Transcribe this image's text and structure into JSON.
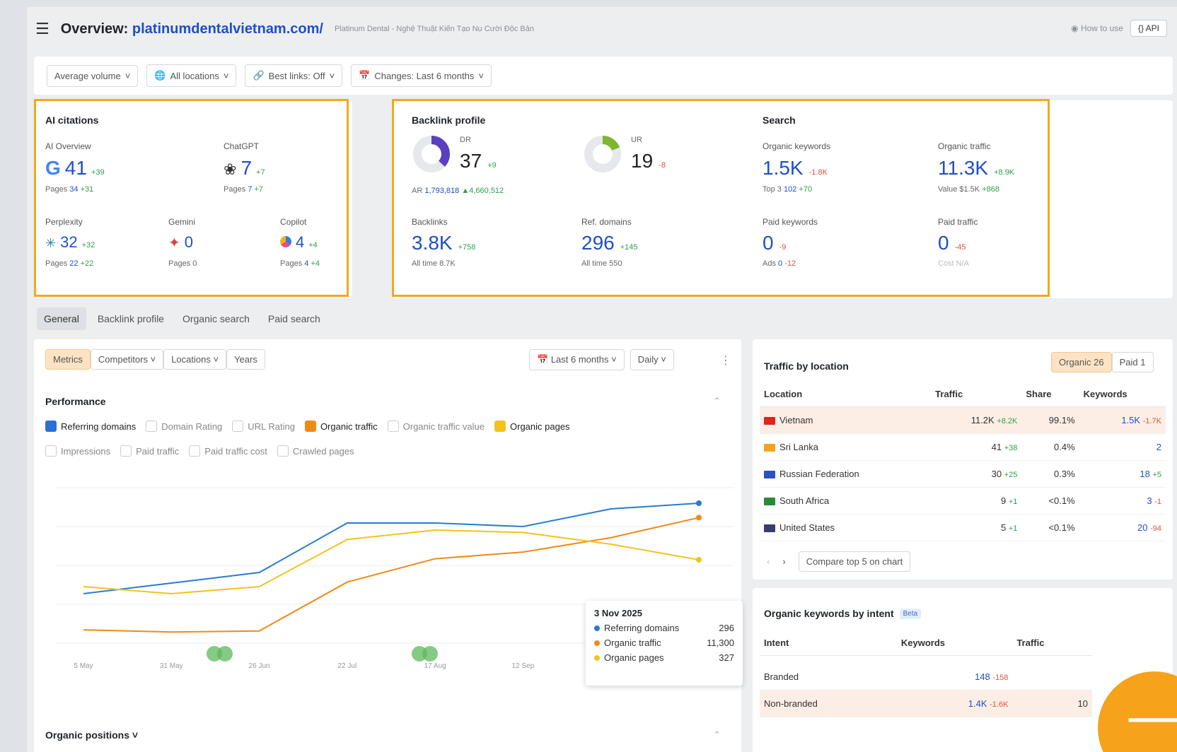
{
  "header": {
    "title_prefix": "Overview:",
    "domain": "platinumdentalvietnam.com/",
    "subtitle": "Platinum Dental - Nghệ Thuật Kiến Tạo Nụ Cười Độc Bản",
    "how_to_use": "How to use",
    "api": "API"
  },
  "filters": {
    "volume": "Average volume",
    "locations": "All locations",
    "best_links": "Best links: Off",
    "changes": "Changes: Last 6 months"
  },
  "ai_citations": {
    "title": "AI citations",
    "overview": {
      "label": "AI Overview",
      "value": "41",
      "delta": "+39",
      "pages_label": "Pages",
      "pages": "34",
      "pages_delta": "+31"
    },
    "chatgpt": {
      "label": "ChatGPT",
      "value": "7",
      "delta": "+7",
      "pages_label": "Pages",
      "pages": "7",
      "pages_delta": "+7"
    },
    "perplexity": {
      "label": "Perplexity",
      "value": "32",
      "delta": "+32",
      "pages_label": "Pages",
      "pages": "22",
      "pages_delta": "+22"
    },
    "gemini": {
      "label": "Gemini",
      "value": "0",
      "pages_label": "Pages",
      "pages": "0"
    },
    "copilot": {
      "label": "Copilot",
      "value": "4",
      "delta": "+4",
      "pages_label": "Pages",
      "pages": "4",
      "pages_delta": "+4"
    }
  },
  "backlink": {
    "title": "Backlink profile",
    "dr": {
      "label": "DR",
      "value": "37",
      "delta": "+9",
      "ar_label": "AR",
      "ar": "1,793,818",
      "ar_delta": "▲4,660,512",
      "ring_fraction": 0.37
    },
    "ur": {
      "label": "UR",
      "value": "19",
      "delta": "-8",
      "ring_fraction": 0.19
    },
    "backlinks": {
      "label": "Backlinks",
      "value": "3.8K",
      "delta": "+758",
      "sub_label": "All time",
      "sub": "8.7K"
    },
    "refdomains": {
      "label": "Ref. domains",
      "value": "296",
      "delta": "+145",
      "sub_label": "All time",
      "sub": "550"
    }
  },
  "search": {
    "title": "Search",
    "org_kw": {
      "label": "Organic keywords",
      "value": "1.5K",
      "delta": "-1.8K",
      "sub_label": "Top 3",
      "sub": "102",
      "sub_delta": "+70"
    },
    "org_traffic": {
      "label": "Organic traffic",
      "value": "11.3K",
      "delta": "+8.9K",
      "sub_label": "Value",
      "sub": "$1.5K",
      "sub_delta": "+868"
    },
    "paid_kw": {
      "label": "Paid keywords",
      "value": "0",
      "delta": "-9",
      "sub_label": "Ads",
      "sub": "0",
      "sub_delta": "-12"
    },
    "paid_traffic": {
      "label": "Paid traffic",
      "value": "0",
      "delta": "-45",
      "sub": "Cost N/A"
    }
  },
  "tabs": [
    "General",
    "Backlink profile",
    "Organic search",
    "Paid search"
  ],
  "chart_controls": {
    "metrics": "Metrics",
    "competitors": "Competitors",
    "locations": "Locations",
    "years": "Years",
    "period": "Last 6 months",
    "granularity": "Daily"
  },
  "performance": {
    "title": "Performance",
    "checkboxes": [
      {
        "label": "Referring domains",
        "state": "blue"
      },
      {
        "label": "Domain Rating",
        "state": "off"
      },
      {
        "label": "URL Rating",
        "state": "off"
      },
      {
        "label": "Organic traffic",
        "state": "orange"
      },
      {
        "label": "Organic traffic value",
        "state": "off"
      },
      {
        "label": "Organic pages",
        "state": "yellow"
      },
      {
        "label": "Impressions",
        "state": "off"
      },
      {
        "label": "Paid traffic",
        "state": "off"
      },
      {
        "label": "Paid traffic cost",
        "state": "off"
      },
      {
        "label": "Crawled pages",
        "state": "off"
      }
    ],
    "x_ticks": [
      "5 May",
      "31 May",
      "26 Jun",
      "22 Jul",
      "17 Aug",
      "12 Sep",
      "8 Oct",
      "3 Nov"
    ],
    "colors": {
      "ref": "#2a7bd1",
      "traffic": "#f08a17",
      "pages": "#f5c21b"
    }
  },
  "chart_data": {
    "type": "line",
    "x": [
      "5 May",
      "31 May",
      "26 Jun",
      "22 Jul",
      "17 Aug",
      "12 Sep",
      "8 Oct",
      "3 Nov"
    ],
    "series": [
      {
        "name": "Referring domains",
        "values": [
          170,
          185,
          200,
          270,
          270,
          265,
          290,
          298
        ]
      },
      {
        "name": "Organic traffic",
        "values": [
          1200,
          1000,
          1100,
          5500,
          7600,
          8200,
          9500,
          11300
        ]
      },
      {
        "name": "Organic pages",
        "values": [
          270,
          255,
          270,
          370,
          390,
          385,
          360,
          327
        ]
      }
    ],
    "tooltip": {
      "date": "3 Nov 2025",
      "rows": [
        {
          "name": "Referring domains",
          "value": "296"
        },
        {
          "name": "Organic traffic",
          "value": "11,300"
        },
        {
          "name": "Organic pages",
          "value": "327"
        }
      ]
    }
  },
  "organic_positions": "Organic positions",
  "traffic_by_location": {
    "title": "Traffic by location",
    "organic_btn": "Organic",
    "organic_count": "26",
    "paid_btn": "Paid",
    "paid_count": "1",
    "columns": [
      "Location",
      "Traffic",
      "Share",
      "Keywords"
    ],
    "rows": [
      {
        "location": "Vietnam",
        "traffic": "11.2K",
        "traffic_delta": "+8.2K",
        "share": "99.1%",
        "keywords": "1.5K",
        "kw_delta": "-1.7K",
        "flag": "#e0241b"
      },
      {
        "location": "Sri Lanka",
        "traffic": "41",
        "traffic_delta": "+38",
        "share": "0.4%",
        "keywords": "2",
        "kw_delta": "",
        "flag": "#f2a41f"
      },
      {
        "location": "Russian Federation",
        "traffic": "30",
        "traffic_delta": "+25",
        "share": "0.3%",
        "keywords": "18",
        "kw_delta": "+5",
        "flag": "#2a52be"
      },
      {
        "location": "South Africa",
        "traffic": "9",
        "traffic_delta": "+1",
        "share": "<0.1%",
        "keywords": "3",
        "kw_delta": "-1",
        "flag": "#2a8a3a"
      },
      {
        "location": "United States",
        "traffic": "5",
        "traffic_delta": "+1",
        "share": "<0.1%",
        "keywords": "20",
        "kw_delta": "-94",
        "flag": "#3c3b6e"
      }
    ],
    "compare": "Compare top 5 on chart"
  },
  "intent": {
    "title": "Organic keywords by intent",
    "beta": "Beta",
    "columns": [
      "Intent",
      "Keywords",
      "Traffic"
    ],
    "rows": [
      {
        "intent": "Branded",
        "keywords": "148",
        "delta": "-158",
        "traffic": ""
      },
      {
        "intent": "Non-branded",
        "keywords": "1.4K",
        "delta": "-1.6K",
        "traffic": "10"
      }
    ]
  }
}
